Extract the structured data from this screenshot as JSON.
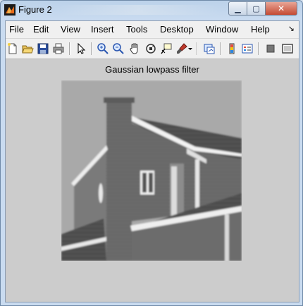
{
  "window": {
    "title": "Figure 2",
    "icon": "matlab-figure-icon",
    "caption_buttons": {
      "minimize": "minimize-icon",
      "maximize": "maximize-icon",
      "close": "close-icon"
    }
  },
  "menubar": {
    "items": [
      "File",
      "Edit",
      "View",
      "Insert",
      "Tools",
      "Desktop",
      "Window",
      "Help"
    ],
    "overflow_icon": "dock-arrow-icon"
  },
  "toolbar": {
    "buttons": [
      "new-figure-icon",
      "open-file-icon",
      "save-figure-icon",
      "print-figure-icon",
      "edit-plot-arrow-icon",
      "zoom-in-icon",
      "zoom-out-icon",
      "pan-hand-icon",
      "rotate-3d-icon",
      "data-cursor-icon",
      "brush-icon",
      "brush-dropdown-icon",
      "link-plot-icon",
      "insert-colorbar-icon",
      "insert-legend-icon",
      "hide-plot-tools-icon",
      "show-plot-tools-icon"
    ]
  },
  "plot": {
    "title": "Gaussian lowpass filter",
    "image_description": "grayscale house"
  },
  "colors": {
    "figure_background": "#cccccc",
    "menubar_background": "#f0f0f0",
    "close_button": "#c44a33"
  }
}
